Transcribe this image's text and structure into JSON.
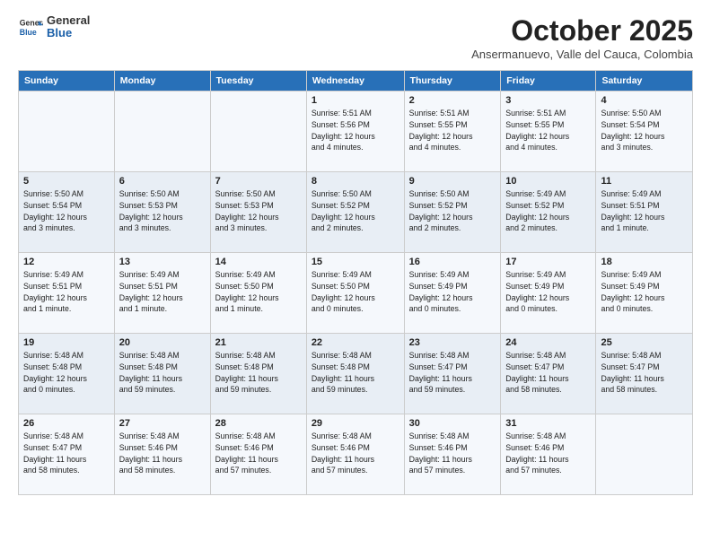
{
  "header": {
    "logo_general": "General",
    "logo_blue": "Blue",
    "month": "October 2025",
    "location": "Ansermanuevo, Valle del Cauca, Colombia"
  },
  "days_of_week": [
    "Sunday",
    "Monday",
    "Tuesday",
    "Wednesday",
    "Thursday",
    "Friday",
    "Saturday"
  ],
  "weeks": [
    [
      {
        "day": "",
        "info": ""
      },
      {
        "day": "",
        "info": ""
      },
      {
        "day": "",
        "info": ""
      },
      {
        "day": "1",
        "info": "Sunrise: 5:51 AM\nSunset: 5:56 PM\nDaylight: 12 hours\nand 4 minutes."
      },
      {
        "day": "2",
        "info": "Sunrise: 5:51 AM\nSunset: 5:55 PM\nDaylight: 12 hours\nand 4 minutes."
      },
      {
        "day": "3",
        "info": "Sunrise: 5:51 AM\nSunset: 5:55 PM\nDaylight: 12 hours\nand 4 minutes."
      },
      {
        "day": "4",
        "info": "Sunrise: 5:50 AM\nSunset: 5:54 PM\nDaylight: 12 hours\nand 3 minutes."
      }
    ],
    [
      {
        "day": "5",
        "info": "Sunrise: 5:50 AM\nSunset: 5:54 PM\nDaylight: 12 hours\nand 3 minutes."
      },
      {
        "day": "6",
        "info": "Sunrise: 5:50 AM\nSunset: 5:53 PM\nDaylight: 12 hours\nand 3 minutes."
      },
      {
        "day": "7",
        "info": "Sunrise: 5:50 AM\nSunset: 5:53 PM\nDaylight: 12 hours\nand 3 minutes."
      },
      {
        "day": "8",
        "info": "Sunrise: 5:50 AM\nSunset: 5:52 PM\nDaylight: 12 hours\nand 2 minutes."
      },
      {
        "day": "9",
        "info": "Sunrise: 5:50 AM\nSunset: 5:52 PM\nDaylight: 12 hours\nand 2 minutes."
      },
      {
        "day": "10",
        "info": "Sunrise: 5:49 AM\nSunset: 5:52 PM\nDaylight: 12 hours\nand 2 minutes."
      },
      {
        "day": "11",
        "info": "Sunrise: 5:49 AM\nSunset: 5:51 PM\nDaylight: 12 hours\nand 1 minute."
      }
    ],
    [
      {
        "day": "12",
        "info": "Sunrise: 5:49 AM\nSunset: 5:51 PM\nDaylight: 12 hours\nand 1 minute."
      },
      {
        "day": "13",
        "info": "Sunrise: 5:49 AM\nSunset: 5:51 PM\nDaylight: 12 hours\nand 1 minute."
      },
      {
        "day": "14",
        "info": "Sunrise: 5:49 AM\nSunset: 5:50 PM\nDaylight: 12 hours\nand 1 minute."
      },
      {
        "day": "15",
        "info": "Sunrise: 5:49 AM\nSunset: 5:50 PM\nDaylight: 12 hours\nand 0 minutes."
      },
      {
        "day": "16",
        "info": "Sunrise: 5:49 AM\nSunset: 5:49 PM\nDaylight: 12 hours\nand 0 minutes."
      },
      {
        "day": "17",
        "info": "Sunrise: 5:49 AM\nSunset: 5:49 PM\nDaylight: 12 hours\nand 0 minutes."
      },
      {
        "day": "18",
        "info": "Sunrise: 5:49 AM\nSunset: 5:49 PM\nDaylight: 12 hours\nand 0 minutes."
      }
    ],
    [
      {
        "day": "19",
        "info": "Sunrise: 5:48 AM\nSunset: 5:48 PM\nDaylight: 12 hours\nand 0 minutes."
      },
      {
        "day": "20",
        "info": "Sunrise: 5:48 AM\nSunset: 5:48 PM\nDaylight: 11 hours\nand 59 minutes."
      },
      {
        "day": "21",
        "info": "Sunrise: 5:48 AM\nSunset: 5:48 PM\nDaylight: 11 hours\nand 59 minutes."
      },
      {
        "day": "22",
        "info": "Sunrise: 5:48 AM\nSunset: 5:48 PM\nDaylight: 11 hours\nand 59 minutes."
      },
      {
        "day": "23",
        "info": "Sunrise: 5:48 AM\nSunset: 5:47 PM\nDaylight: 11 hours\nand 59 minutes."
      },
      {
        "day": "24",
        "info": "Sunrise: 5:48 AM\nSunset: 5:47 PM\nDaylight: 11 hours\nand 58 minutes."
      },
      {
        "day": "25",
        "info": "Sunrise: 5:48 AM\nSunset: 5:47 PM\nDaylight: 11 hours\nand 58 minutes."
      }
    ],
    [
      {
        "day": "26",
        "info": "Sunrise: 5:48 AM\nSunset: 5:47 PM\nDaylight: 11 hours\nand 58 minutes."
      },
      {
        "day": "27",
        "info": "Sunrise: 5:48 AM\nSunset: 5:46 PM\nDaylight: 11 hours\nand 58 minutes."
      },
      {
        "day": "28",
        "info": "Sunrise: 5:48 AM\nSunset: 5:46 PM\nDaylight: 11 hours\nand 57 minutes."
      },
      {
        "day": "29",
        "info": "Sunrise: 5:48 AM\nSunset: 5:46 PM\nDaylight: 11 hours\nand 57 minutes."
      },
      {
        "day": "30",
        "info": "Sunrise: 5:48 AM\nSunset: 5:46 PM\nDaylight: 11 hours\nand 57 minutes."
      },
      {
        "day": "31",
        "info": "Sunrise: 5:48 AM\nSunset: 5:46 PM\nDaylight: 11 hours\nand 57 minutes."
      },
      {
        "day": "",
        "info": ""
      }
    ]
  ]
}
